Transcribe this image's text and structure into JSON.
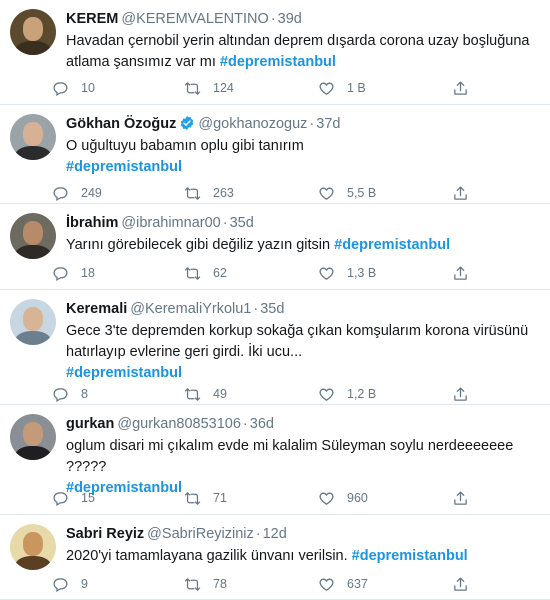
{
  "tweets": [
    {
      "name": "KEREM",
      "handle": "@KEREMVALENTINO",
      "sep": "·",
      "time": "39d",
      "verified": false,
      "lines": [
        "Havadan çernobil yerin altından deprem dışarda corona uzay boşluğuna",
        "atlama şansımız var mı "
      ],
      "hashtag": "#depremistanbul",
      "replies": "10",
      "retweets": "124",
      "likes": "1 B",
      "avatar_colors": {
        "bg": "#5b4a2e",
        "face": "#c9a27a",
        "body": "#3a2f1f"
      }
    },
    {
      "name": "Gökhan Özoğuz",
      "handle": "@gokhanozoguz",
      "sep": "·",
      "time": "37d",
      "verified": true,
      "lines": [
        "O uğultuyu babamın oplu gibi tanırım"
      ],
      "hashtag": "#depremistanbul",
      "replies": "249",
      "retweets": "263",
      "likes": "5,5 B",
      "avatar_colors": {
        "bg": "#9aa4a8",
        "face": "#d6b196",
        "body": "#2b2b2b"
      }
    },
    {
      "name": "İbrahim",
      "handle": "@ibrahimnar00",
      "sep": "·",
      "time": "35d",
      "verified": false,
      "lines": [
        "Yarını görebilecek gibi değiliz yazın gitsin "
      ],
      "hashtag": "#depremistanbul",
      "replies": "18",
      "retweets": "62",
      "likes": "1,3 B",
      "avatar_colors": {
        "bg": "#6d6a5f",
        "face": "#b88b68",
        "body": "#2e2a25"
      }
    },
    {
      "name": "Keremali",
      "handle": "@KeremaliYrkolu1",
      "sep": "·",
      "time": "35d",
      "verified": false,
      "lines": [
        "Gece 3'te depremden korkup sokağa çıkan komşularım korona virüsünü",
        "hatırlayıp evlerine geri girdi. İki ucu..."
      ],
      "hashtag": "#depremistanbul",
      "replies": "8",
      "retweets": "49",
      "likes": "1,2 B",
      "avatar_colors": {
        "bg": "#c7d7e2",
        "face": "#d8b496",
        "body": "#6b7f8f"
      }
    },
    {
      "name": "gurkan",
      "handle": "@gurkan80853106",
      "sep": "·",
      "time": "36d",
      "verified": false,
      "lines": [
        "oglum disari mi çıkalım evde mi kalalim Süleyman soylu nerdeeeeeee",
        "?????"
      ],
      "hashtag": "#depremistanbul",
      "replies": "15",
      "retweets": "71",
      "likes": "960",
      "avatar_colors": {
        "bg": "#8a8f95",
        "face": "#c49b7a",
        "body": "#1f1f22"
      }
    },
    {
      "name": "Sabri Reyiz",
      "handle": "@SabriReyiziniz",
      "sep": "·",
      "time": "12d",
      "verified": false,
      "lines": [
        "2020'yi tamamlayana gazilik ünvanı verilsin. "
      ],
      "hashtag": "#depremistanbul",
      "replies": "9",
      "retweets": "78",
      "likes": "637",
      "avatar_colors": {
        "bg": "#e7d9a8",
        "face": "#c9965f",
        "body": "#5a3f22"
      }
    }
  ],
  "colors": {
    "hashtag": "#1b95e0",
    "verified": "#1da1f2",
    "muted": "#657786"
  },
  "icons": [
    "reply-icon",
    "retweet-icon",
    "like-icon",
    "share-icon",
    "verified-badge-icon"
  ]
}
